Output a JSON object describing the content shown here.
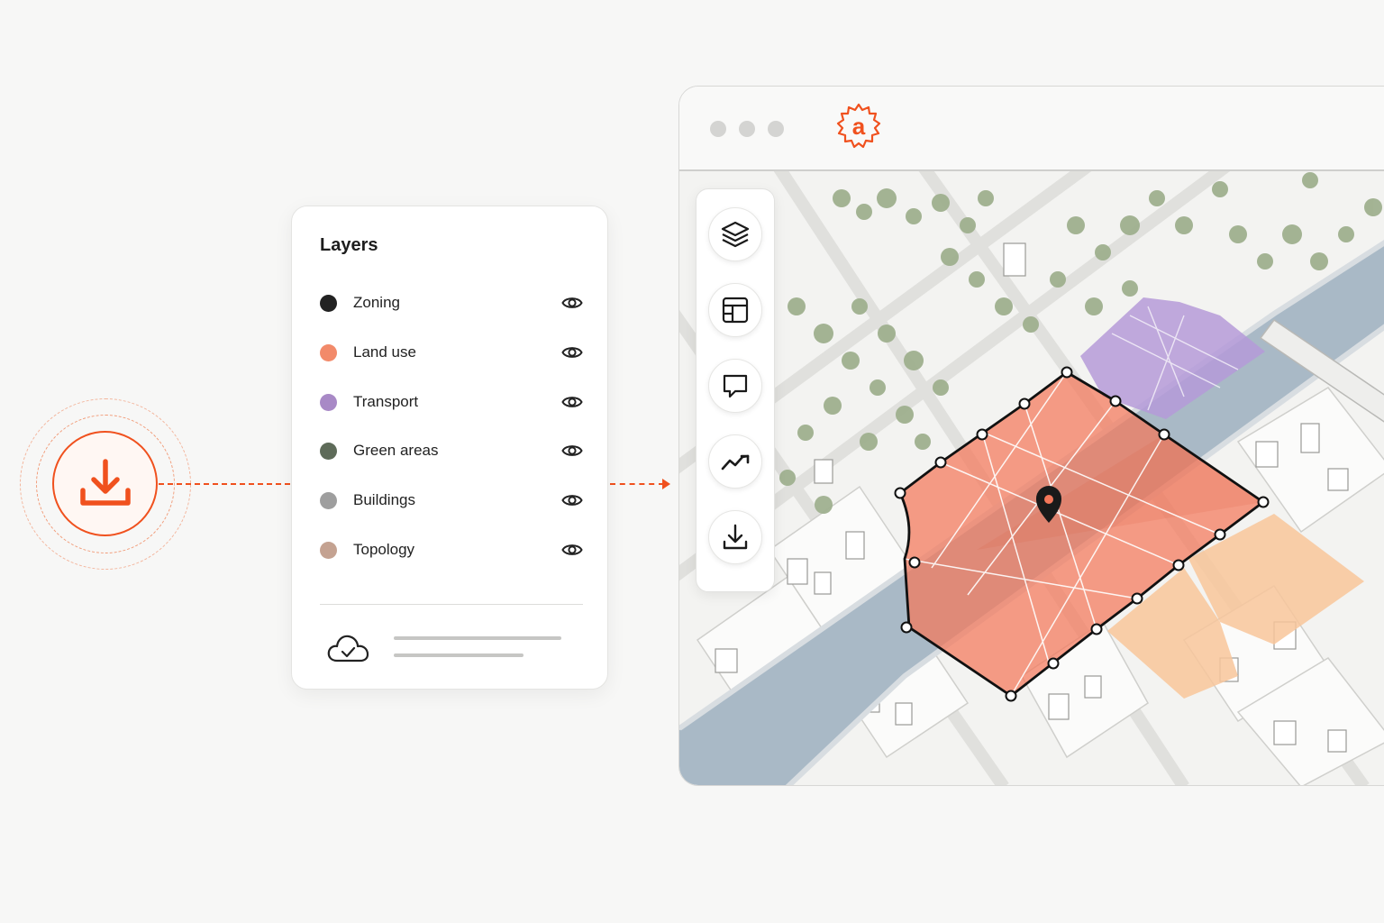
{
  "layers_panel": {
    "title": "Layers",
    "items": [
      {
        "label": "Zoning",
        "color": "#222222",
        "visible": true
      },
      {
        "label": "Land use",
        "color": "#f28a6a",
        "visible": true
      },
      {
        "label": "Transport",
        "color": "#a889c6",
        "visible": true
      },
      {
        "label": "Green areas",
        "color": "#5e6b59",
        "visible": true
      },
      {
        "label": "Buildings",
        "color": "#9e9e9e",
        "visible": true
      },
      {
        "label": "Topology",
        "color": "#c4a291",
        "visible": true
      }
    ],
    "footer_icon": "cloud-check-icon"
  },
  "hero": {
    "icon": "download-icon",
    "accent": "#f0511e"
  },
  "app": {
    "logo": "a",
    "toolbar": [
      "layers-icon",
      "layout-icon",
      "comment-icon",
      "chart-line-icon",
      "download-icon"
    ]
  },
  "map_colors": {
    "selection": "#f4775a",
    "transport": "#b59ad8",
    "topology": "#f8c59a",
    "water": "#a9b9c6",
    "green": "#9fb08f"
  }
}
